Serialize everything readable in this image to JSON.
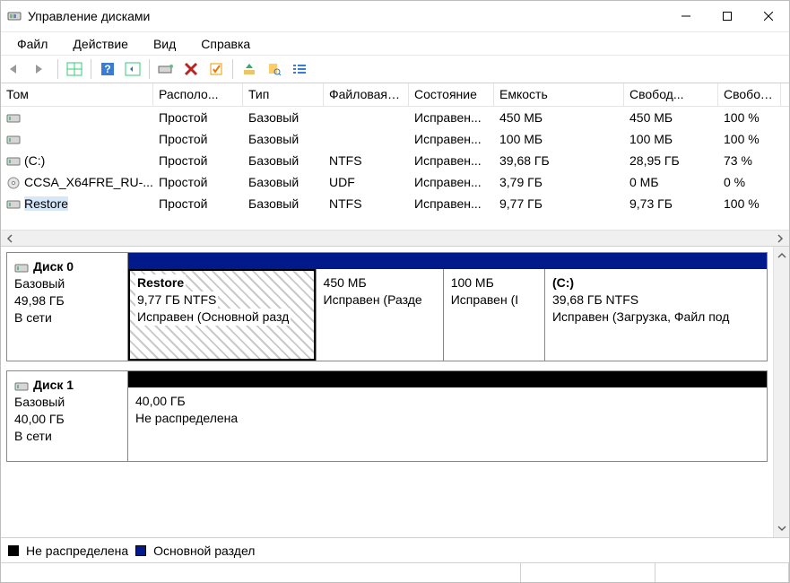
{
  "window": {
    "title": "Управление дисками"
  },
  "menu": {
    "file": "Файл",
    "action": "Действие",
    "view": "Вид",
    "help": "Справка"
  },
  "columns": {
    "volume": "Том",
    "layout": "Располо...",
    "type": "Тип",
    "fs": "Файловая с...",
    "status": "Состояние",
    "capacity": "Емкость",
    "free": "Свобод...",
    "freepct": "Свобод..."
  },
  "volumes": [
    {
      "name": "",
      "layout": "Простой",
      "type": "Базовый",
      "fs": "",
      "status": "Исправен...",
      "capacity": "450 МБ",
      "free": "450 МБ",
      "freepct": "100 %",
      "icon": "drive"
    },
    {
      "name": "",
      "layout": "Простой",
      "type": "Базовый",
      "fs": "",
      "status": "Исправен...",
      "capacity": "100 МБ",
      "free": "100 МБ",
      "freepct": "100 %",
      "icon": "drive"
    },
    {
      "name": "(C:)",
      "layout": "Простой",
      "type": "Базовый",
      "fs": "NTFS",
      "status": "Исправен...",
      "capacity": "39,68 ГБ",
      "free": "28,95 ГБ",
      "freepct": "73 %",
      "icon": "drive"
    },
    {
      "name": "CCSA_X64FRE_RU-...",
      "layout": "Простой",
      "type": "Базовый",
      "fs": "UDF",
      "status": "Исправен...",
      "capacity": "3,79 ГБ",
      "free": "0 МБ",
      "freepct": "0 %",
      "icon": "disc"
    },
    {
      "name": "Restore",
      "layout": "Простой",
      "type": "Базовый",
      "fs": "NTFS",
      "status": "Исправен...",
      "capacity": "9,77 ГБ",
      "free": "9,73 ГБ",
      "freepct": "100 %",
      "icon": "drive",
      "selected": true
    }
  ],
  "disks": [
    {
      "label": "Диск 0",
      "type": "Базовый",
      "size": "49,98 ГБ",
      "state": "В сети",
      "stripe_color": "blue",
      "partitions": [
        {
          "name": "Restore",
          "line2": "9,77 ГБ NTFS",
          "line3": "Исправен (Основной разд",
          "flex": 20,
          "selected": true
        },
        {
          "name": "",
          "line2": "450 МБ",
          "line3": "Исправен (Разде",
          "flex": 13
        },
        {
          "name": "",
          "line2": "100 МБ",
          "line3": "Исправен (I",
          "flex": 10
        },
        {
          "name": "(C:)",
          "line2": "39,68 ГБ NTFS",
          "line3": "Исправен (Загрузка, Файл под",
          "flex": 24
        }
      ]
    },
    {
      "label": "Диск 1",
      "type": "Базовый",
      "size": "40,00 ГБ",
      "state": "В сети",
      "stripe_color": "black",
      "partitions": [
        {
          "name": "",
          "line2": "40,00 ГБ",
          "line3": "Не распределена",
          "flex": 1
        }
      ]
    }
  ],
  "legend": {
    "unallocated": "Не распределена",
    "primary": "Основной раздел"
  }
}
